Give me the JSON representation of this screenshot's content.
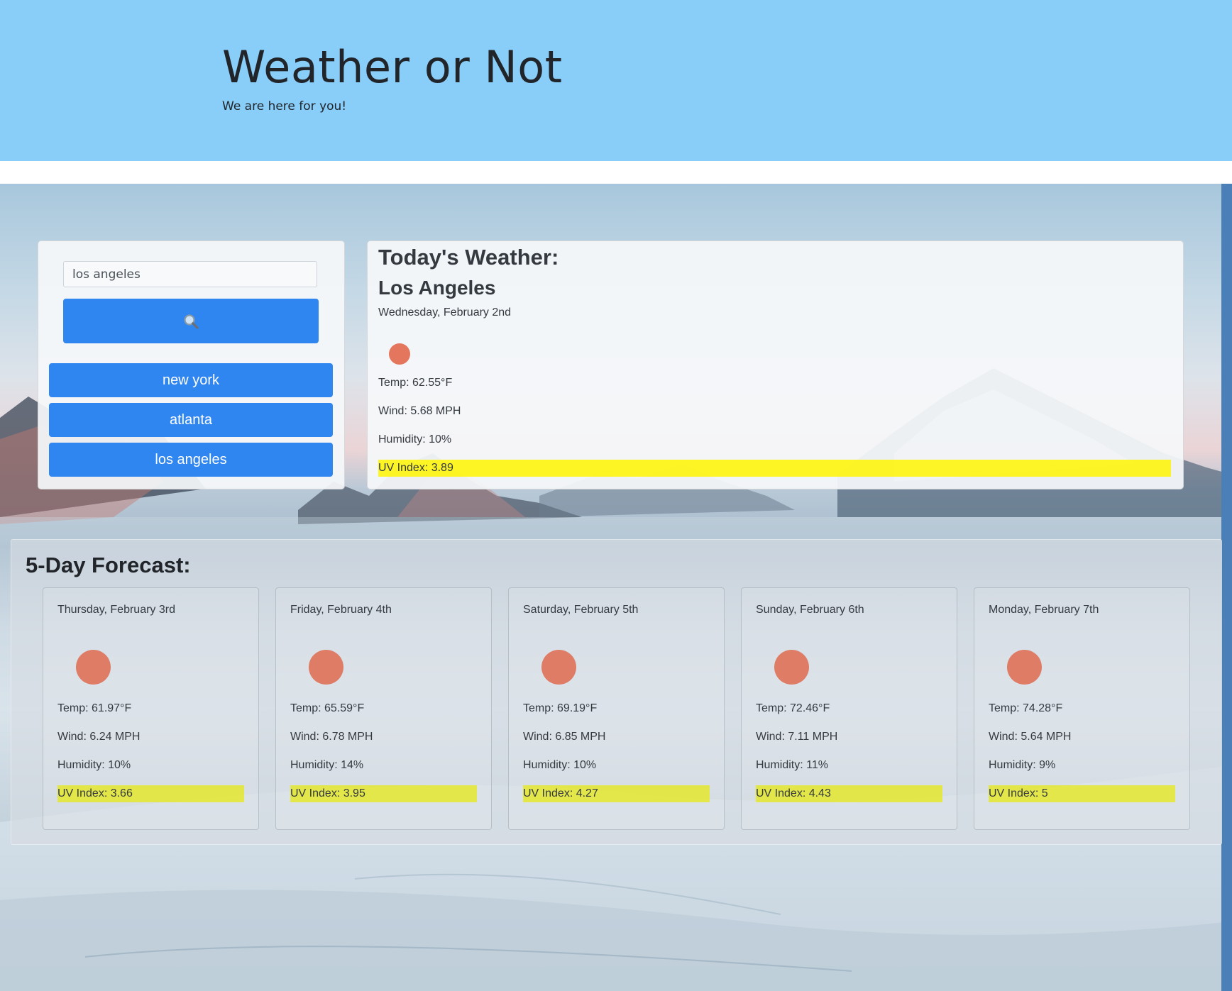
{
  "header": {
    "title": "Weather or Not",
    "subtitle": "We are here for you!"
  },
  "search": {
    "value": "los angeles",
    "button_icon": "search-icon",
    "history": [
      "new york",
      "atlanta",
      "los angeles"
    ]
  },
  "today": {
    "heading": "Today's Weather:",
    "city": "Los Angeles",
    "date": "Wednesday, February 2nd",
    "icon": "sun-icon",
    "temp": "Temp: 62.55°F",
    "wind": "Wind: 5.68 MPH",
    "humidity": "Humidity: 10%",
    "uv": "UV Index: 3.89"
  },
  "forecast": {
    "heading": "5-Day Forecast:",
    "days": [
      {
        "date": "Thursday, February 3rd",
        "icon": "sun-icon",
        "temp": "Temp: 61.97°F",
        "wind": "Wind: 6.24 MPH",
        "humidity": "Humidity: 10%",
        "uv": "UV Index: 3.66"
      },
      {
        "date": "Friday, February 4th",
        "icon": "sun-icon",
        "temp": "Temp: 65.59°F",
        "wind": "Wind: 6.78 MPH",
        "humidity": "Humidity: 14%",
        "uv": "UV Index: 3.95"
      },
      {
        "date": "Saturday, February 5th",
        "icon": "sun-icon",
        "temp": "Temp: 69.19°F",
        "wind": "Wind: 6.85 MPH",
        "humidity": "Humidity: 10%",
        "uv": "UV Index: 4.27"
      },
      {
        "date": "Sunday, February 6th",
        "icon": "sun-icon",
        "temp": "Temp: 72.46°F",
        "wind": "Wind: 7.11 MPH",
        "humidity": "Humidity: 11%",
        "uv": "UV Index: 4.43"
      },
      {
        "date": "Monday, February 7th",
        "icon": "sun-icon",
        "temp": "Temp: 74.28°F",
        "wind": "Wind: 5.64 MPH",
        "humidity": "Humidity: 9%",
        "uv": "UV Index: 5"
      }
    ]
  },
  "colors": {
    "header_bg": "#89cdf9",
    "button_blue": "#2f86f0",
    "uv_highlight": "#fff500",
    "sun": "#e3765c"
  }
}
